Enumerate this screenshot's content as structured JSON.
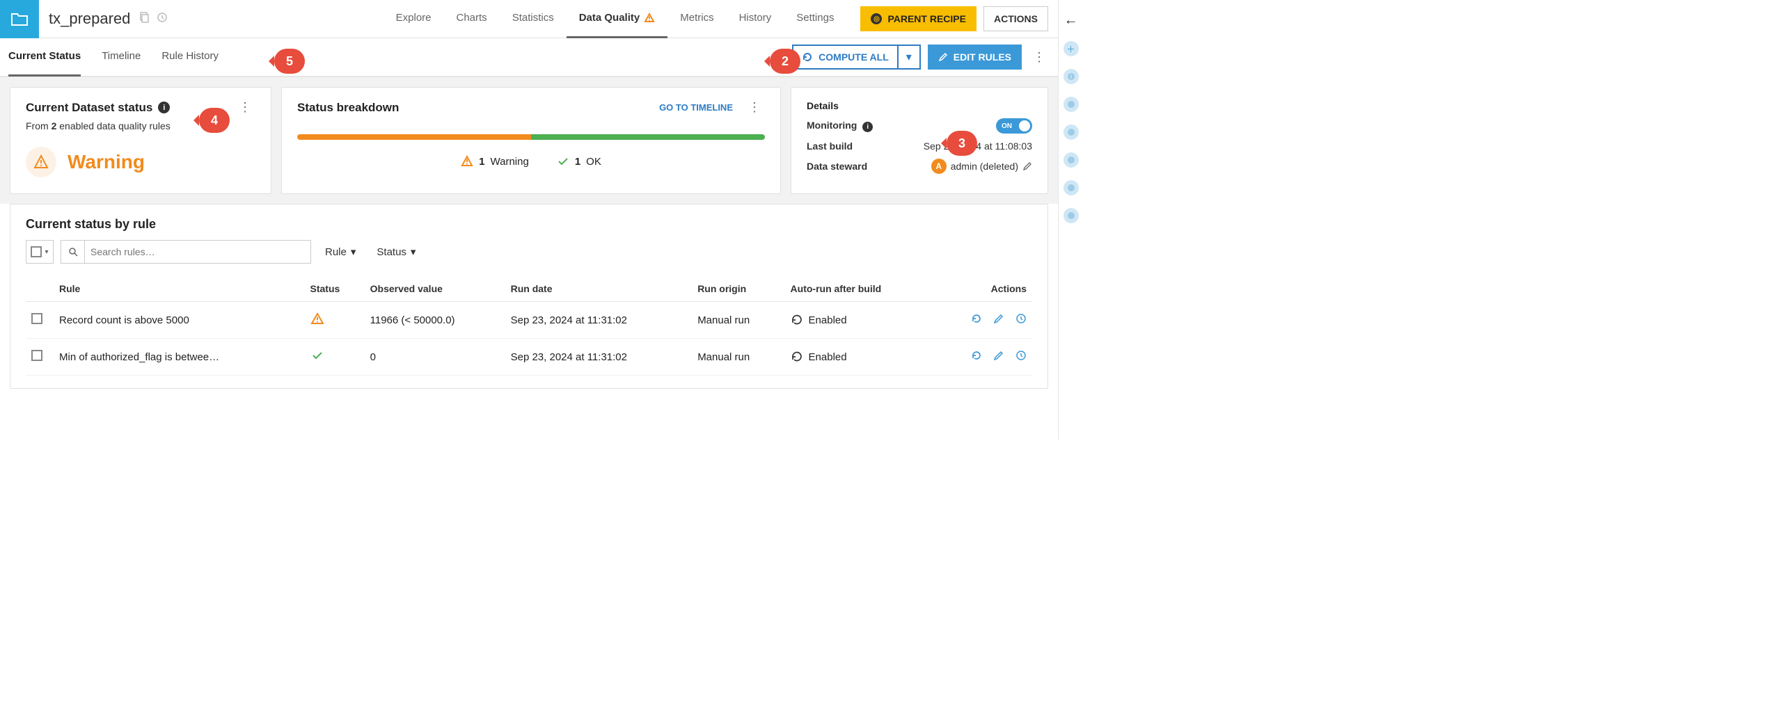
{
  "header": {
    "dataset_title": "tx_prepared",
    "tabs": [
      "Explore",
      "Charts",
      "Statistics",
      "Data Quality",
      "Metrics",
      "History",
      "Settings"
    ],
    "active_tab": "Data Quality",
    "parent_recipe_label": "PARENT RECIPE",
    "actions_label": "ACTIONS"
  },
  "subtabs": {
    "items": [
      "Current Status",
      "Timeline",
      "Rule History"
    ],
    "active": "Current Status",
    "compute_all_label": "COMPUTE ALL",
    "edit_rules_label": "EDIT RULES"
  },
  "status_card": {
    "title": "Current Dataset status",
    "sub_prefix": "From ",
    "enabled_count": "2",
    "sub_suffix": " enabled data quality rules",
    "status_text": "Warning"
  },
  "breakdown_card": {
    "title": "Status breakdown",
    "goto_label": "GO TO TIMELINE",
    "warning_count": "1",
    "warning_label": "Warning",
    "ok_count": "1",
    "ok_label": "OK"
  },
  "details_card": {
    "title": "Details",
    "monitoring_label": "Monitoring",
    "monitoring_state": "ON",
    "last_build_label": "Last build",
    "last_build_value": "Sep 23, 2024 at 11:08:03",
    "steward_label": "Data steward",
    "steward_initial": "A",
    "steward_value": "admin (deleted)"
  },
  "rules_section": {
    "title": "Current status by rule",
    "search_placeholder": "Search rules…",
    "filter_rule": "Rule",
    "filter_status": "Status",
    "headers": {
      "rule": "Rule",
      "status": "Status",
      "observed": "Observed value",
      "run_date": "Run date",
      "run_origin": "Run origin",
      "auto_run": "Auto-run after build",
      "actions": "Actions"
    },
    "rows": [
      {
        "rule": "Record count is above 5000",
        "status": "warning",
        "observed": "11966 (< 50000.0)",
        "run_date": "Sep 23, 2024 at 11:31:02",
        "run_origin": "Manual run",
        "auto_run": "Enabled"
      },
      {
        "rule": "Min of authorized_flag is betwee…",
        "status": "ok",
        "observed": "0",
        "run_date": "Sep 23, 2024 at 11:31:02",
        "run_origin": "Manual run",
        "auto_run": "Enabled"
      }
    ]
  },
  "callouts": {
    "c2": "2",
    "c3": "3",
    "c4": "4",
    "c5": "5"
  }
}
